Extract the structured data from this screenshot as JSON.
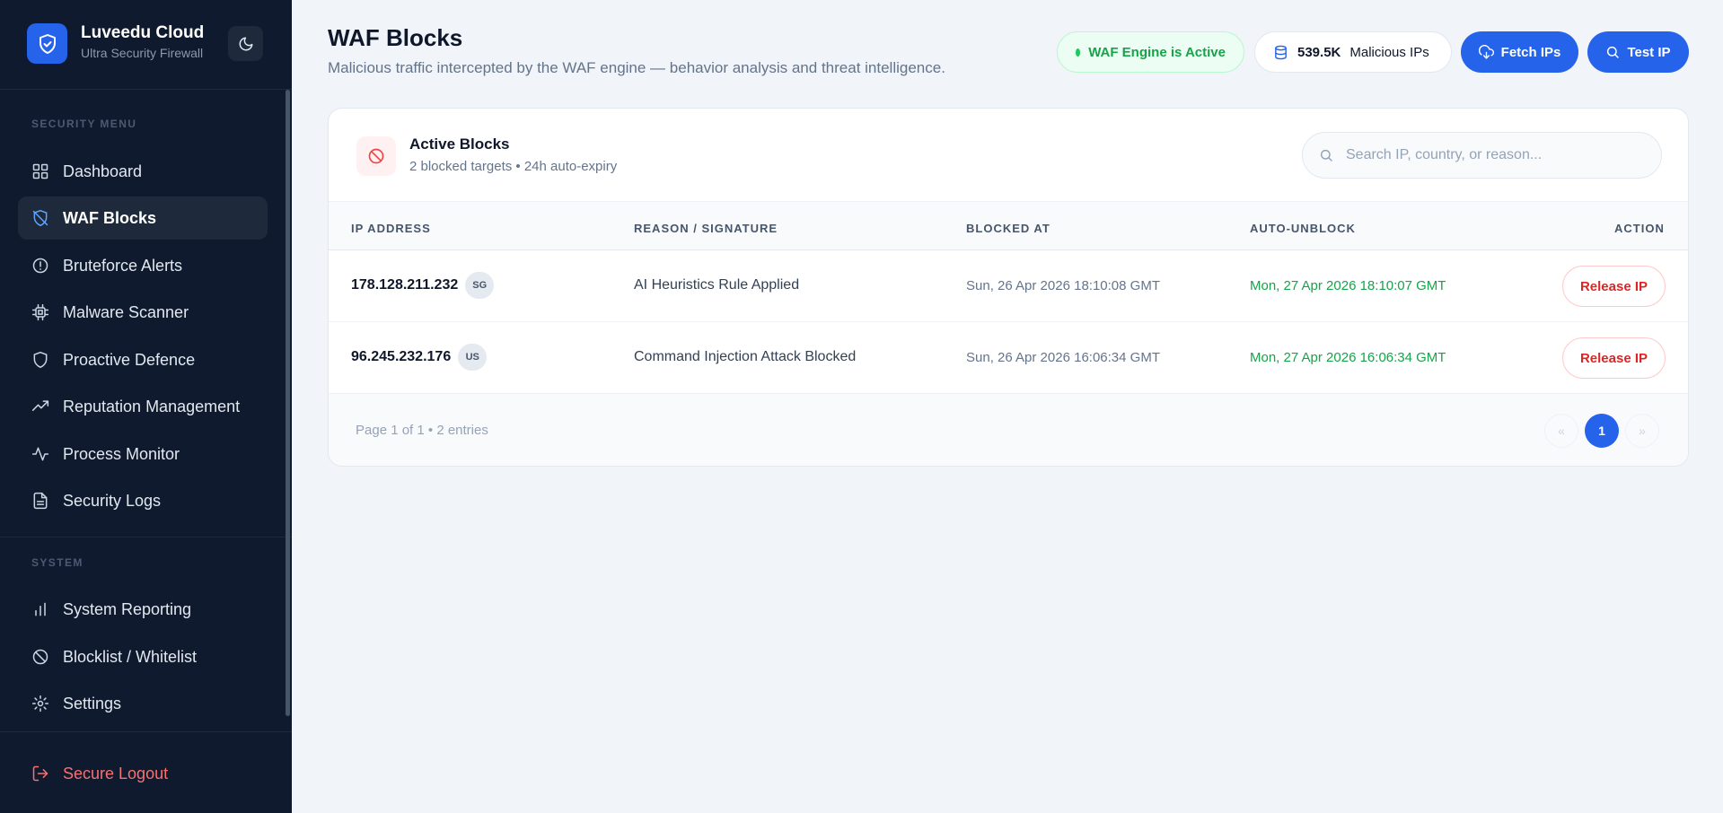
{
  "brand": {
    "name": "Luveedu Cloud",
    "subtitle": "Ultra Security Firewall"
  },
  "sidebar": {
    "security_label": "SECURITY MENU",
    "system_label": "SYSTEM",
    "security_items": [
      {
        "label": "Dashboard",
        "icon": "grid-icon"
      },
      {
        "label": "WAF Blocks",
        "icon": "shield-off-icon",
        "active": true
      },
      {
        "label": "Bruteforce Alerts",
        "icon": "alert-circle-icon"
      },
      {
        "label": "Malware Scanner",
        "icon": "chip-icon"
      },
      {
        "label": "Proactive Defence",
        "icon": "shield-icon"
      },
      {
        "label": "Reputation Management",
        "icon": "trending-up-icon"
      },
      {
        "label": "Process Monitor",
        "icon": "activity-icon"
      },
      {
        "label": "Security Logs",
        "icon": "file-text-icon"
      }
    ],
    "system_items": [
      {
        "label": "System Reporting",
        "icon": "bar-chart-icon"
      },
      {
        "label": "Blocklist / Whitelist",
        "icon": "ban-icon"
      },
      {
        "label": "Settings",
        "icon": "gear-icon"
      }
    ],
    "logout_label": "Secure Logout"
  },
  "header": {
    "title": "WAF Blocks",
    "subtitle": "Malicious traffic intercepted by the WAF engine — behavior analysis and threat intelligence.",
    "status_label": "WAF Engine is Active",
    "malicious_count": "539.5K",
    "malicious_label": "Malicious IPs",
    "fetch_label": "Fetch IPs",
    "test_label": "Test IP"
  },
  "card": {
    "title": "Active Blocks",
    "subtitle": "2 blocked targets • 24h auto-expiry",
    "search_placeholder": "Search IP, country, or reason...",
    "columns": [
      "IP ADDRESS",
      "REASON / SIGNATURE",
      "BLOCKED AT",
      "AUTO-UNBLOCK",
      "ACTION"
    ],
    "rows": [
      {
        "ip": "178.128.211.232",
        "country": "SG",
        "reason": "AI Heuristics Rule Applied",
        "blocked_at": "Sun, 26 Apr 2026 18:10:08 GMT",
        "auto_unblock": "Mon, 27 Apr 2026 18:10:07 GMT",
        "action": "Release IP"
      },
      {
        "ip": "96.245.232.176",
        "country": "US",
        "reason": "Command Injection Attack Blocked",
        "blocked_at": "Sun, 26 Apr 2026 16:06:34 GMT",
        "auto_unblock": "Mon, 27 Apr 2026 16:06:34 GMT",
        "action": "Release IP"
      }
    ],
    "footer_text": "Page 1 of 1 • 2 entries",
    "pagination": {
      "prev": "«",
      "current": "1",
      "next": "»"
    }
  },
  "colors": {
    "accent": "#2563eb",
    "sidebar": "#0f1a2e",
    "success": "#16a34a",
    "danger": "#dc2626"
  }
}
